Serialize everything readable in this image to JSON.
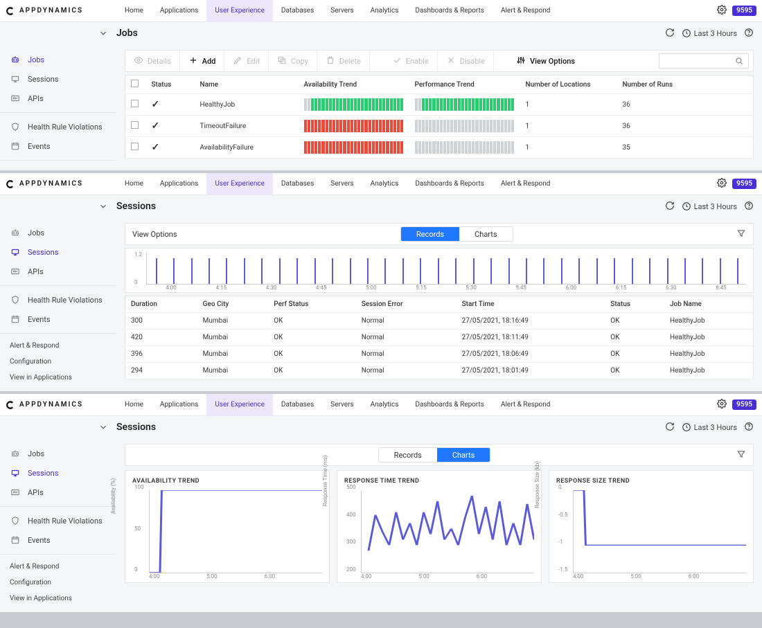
{
  "brand": "APPDYNAMICS",
  "nav_tabs": [
    "Home",
    "Applications",
    "User Experience",
    "Databases",
    "Servers",
    "Analytics",
    "Dashboards & Reports",
    "Alert & Respond"
  ],
  "nav_active": "User Experience",
  "badge": "9595",
  "timerange_label": "Last 3 Hours",
  "sidebar_items": [
    {
      "id": "jobs",
      "label": "Jobs",
      "icon": "robot-icon"
    },
    {
      "id": "sessions",
      "label": "Sessions",
      "icon": "sessions-icon"
    },
    {
      "id": "apis",
      "label": "APIs",
      "icon": "api-icon"
    }
  ],
  "sidebar_items2": [
    {
      "id": "hrv",
      "label": "Health Rule Violations",
      "icon": "shield-icon"
    },
    {
      "id": "events",
      "label": "Events",
      "icon": "calendar-icon"
    }
  ],
  "sidebar_links": [
    "Alert & Respond",
    "Configuration",
    "View in Applications"
  ],
  "panel1": {
    "title": "Jobs",
    "active_side": "jobs",
    "toolbar": {
      "details": "Details",
      "add": "Add",
      "edit": "Edit",
      "copy": "Copy",
      "delete": "Delete",
      "enable": "Enable",
      "disable": "Disable",
      "view_options": "View Options"
    },
    "columns": [
      "",
      "Status",
      "Name",
      "Availability Trend",
      "Performance Trend",
      "Number of Locations",
      "Number of Runs"
    ],
    "rows": [
      {
        "name": "HealthyJob",
        "locations": "1",
        "runs": "36",
        "avail": [
          "grey",
          "grey",
          "green",
          "green",
          "green",
          "green",
          "green",
          "green",
          "green",
          "green",
          "green",
          "green",
          "green",
          "green",
          "green",
          "green",
          "green",
          "green",
          "green",
          "green",
          "green",
          "green",
          "green",
          "green",
          "green",
          "green",
          "green",
          "green"
        ],
        "perf": [
          "grey",
          "grey",
          "green",
          "green",
          "green",
          "green",
          "green",
          "green",
          "green",
          "green",
          "green",
          "green",
          "green",
          "green",
          "green",
          "green",
          "green",
          "green",
          "green",
          "green",
          "green",
          "green",
          "green",
          "green",
          "green",
          "green",
          "green",
          "green"
        ]
      },
      {
        "name": "TimeoutFailure",
        "locations": "1",
        "runs": "36",
        "avail": [
          "red",
          "red",
          "red",
          "red",
          "red",
          "red",
          "red",
          "red",
          "red",
          "red",
          "red",
          "red",
          "red",
          "red",
          "red",
          "red",
          "red",
          "red",
          "red",
          "red",
          "red",
          "red",
          "red",
          "red",
          "red",
          "red",
          "red",
          "red"
        ],
        "perf": [
          "grey",
          "grey",
          "grey",
          "grey",
          "grey",
          "grey",
          "grey",
          "grey",
          "grey",
          "grey",
          "grey",
          "grey",
          "grey",
          "grey",
          "grey",
          "grey",
          "grey",
          "grey",
          "grey",
          "grey",
          "grey",
          "grey",
          "grey",
          "grey",
          "grey",
          "grey",
          "grey",
          "grey"
        ]
      },
      {
        "name": "AvailabilityFailure",
        "locations": "1",
        "runs": "35",
        "avail": [
          "red",
          "red",
          "red",
          "red",
          "red",
          "red",
          "red",
          "red",
          "red",
          "red",
          "red",
          "red",
          "red",
          "red",
          "red",
          "red",
          "red",
          "red",
          "red",
          "red",
          "red",
          "red",
          "red",
          "red",
          "red",
          "red",
          "red",
          "red"
        ],
        "perf": [
          "grey",
          "grey",
          "grey",
          "grey",
          "grey",
          "grey",
          "grey",
          "grey",
          "grey",
          "grey",
          "grey",
          "grey",
          "grey",
          "grey",
          "grey",
          "grey",
          "grey",
          "grey",
          "grey",
          "grey",
          "grey",
          "grey",
          "grey",
          "grey",
          "grey",
          "grey",
          "grey",
          "grey"
        ]
      }
    ]
  },
  "panel2": {
    "title": "Sessions",
    "active_side": "sessions",
    "seg": {
      "records": "Records",
      "charts": "Charts",
      "active": "Records",
      "view_options": "View Options"
    },
    "chart_data": {
      "type": "bar",
      "ylim": [
        0,
        1.2
      ],
      "yticks": [
        0,
        1.2
      ],
      "xticks": [
        "4:00",
        "4:15",
        "4:30",
        "4:45",
        "5:00",
        "5:15",
        "5:30",
        "5:45",
        "6:00",
        "6:15",
        "6:30",
        "6:45"
      ],
      "bars": 34,
      "value": 1.0
    },
    "columns": [
      "Duration",
      "Geo City",
      "Perf Status",
      "Session Error",
      "Start Time",
      "Status",
      "Job Name"
    ],
    "rows": [
      {
        "Duration": "300",
        "Geo City": "Mumbai",
        "Perf Status": "OK",
        "Session Error": "Normal",
        "Start Time": "27/05/2021, 18:16:49",
        "Status": "OK",
        "Job Name": "HealthyJob"
      },
      {
        "Duration": "420",
        "Geo City": "Mumbai",
        "Perf Status": "OK",
        "Session Error": "Normal",
        "Start Time": "27/05/2021, 18:11:49",
        "Status": "OK",
        "Job Name": "HealthyJob"
      },
      {
        "Duration": "396",
        "Geo City": "Mumbai",
        "Perf Status": "OK",
        "Session Error": "Normal",
        "Start Time": "27/05/2021, 18:06:49",
        "Status": "OK",
        "Job Name": "HealthyJob"
      },
      {
        "Duration": "294",
        "Geo City": "Mumbai",
        "Perf Status": "OK",
        "Session Error": "Normal",
        "Start Time": "27/05/2021, 18:01:49",
        "Status": "OK",
        "Job Name": "HealthyJob"
      }
    ]
  },
  "panel3": {
    "title": "Sessions",
    "active_side": "sessions",
    "seg": {
      "records": "Records",
      "charts": "Charts",
      "active": "Charts"
    },
    "cards": [
      {
        "title": "AVAILABILITY TREND",
        "ylabel": "Availability (%)",
        "yticks": [
          "0",
          "50",
          "100"
        ],
        "xticks": [
          "4:00",
          "5:00",
          "6:00"
        ],
        "type": "line",
        "points": [
          [
            0,
            0
          ],
          [
            6,
            0
          ],
          [
            7,
            100
          ],
          [
            100,
            100
          ]
        ]
      },
      {
        "title": "RESPONSE TIME TREND",
        "ylabel": "Response Time (ms)",
        "yticks": [
          "200",
          "300",
          "400",
          "500"
        ],
        "xticks": [
          "4:00",
          "5:00",
          "6:00"
        ],
        "type": "line",
        "points": [
          [
            4,
            280
          ],
          [
            8,
            410
          ],
          [
            12,
            350
          ],
          [
            16,
            300
          ],
          [
            20,
            420
          ],
          [
            24,
            320
          ],
          [
            28,
            380
          ],
          [
            32,
            300
          ],
          [
            36,
            420
          ],
          [
            40,
            340
          ],
          [
            44,
            460
          ],
          [
            48,
            320
          ],
          [
            52,
            360
          ],
          [
            56,
            300
          ],
          [
            60,
            400
          ],
          [
            64,
            480
          ],
          [
            68,
            340
          ],
          [
            72,
            440
          ],
          [
            76,
            320
          ],
          [
            80,
            460
          ],
          [
            84,
            300
          ],
          [
            88,
            380
          ],
          [
            92,
            300
          ],
          [
            96,
            450
          ],
          [
            100,
            320
          ]
        ],
        "yrange": [
          200,
          500
        ]
      },
      {
        "title": "RESPONSE SIZE TREND",
        "ylabel": "Response Size (kb)",
        "yticks": [
          "-1.5",
          "-1",
          "-0.5",
          "0"
        ],
        "xticks": [
          "4:00",
          "5:00",
          "6:00"
        ],
        "type": "line",
        "points": [
          [
            0,
            0
          ],
          [
            6,
            0
          ],
          [
            7,
            -1
          ],
          [
            100,
            -1
          ]
        ],
        "yrange": [
          -1.5,
          0
        ]
      }
    ]
  }
}
